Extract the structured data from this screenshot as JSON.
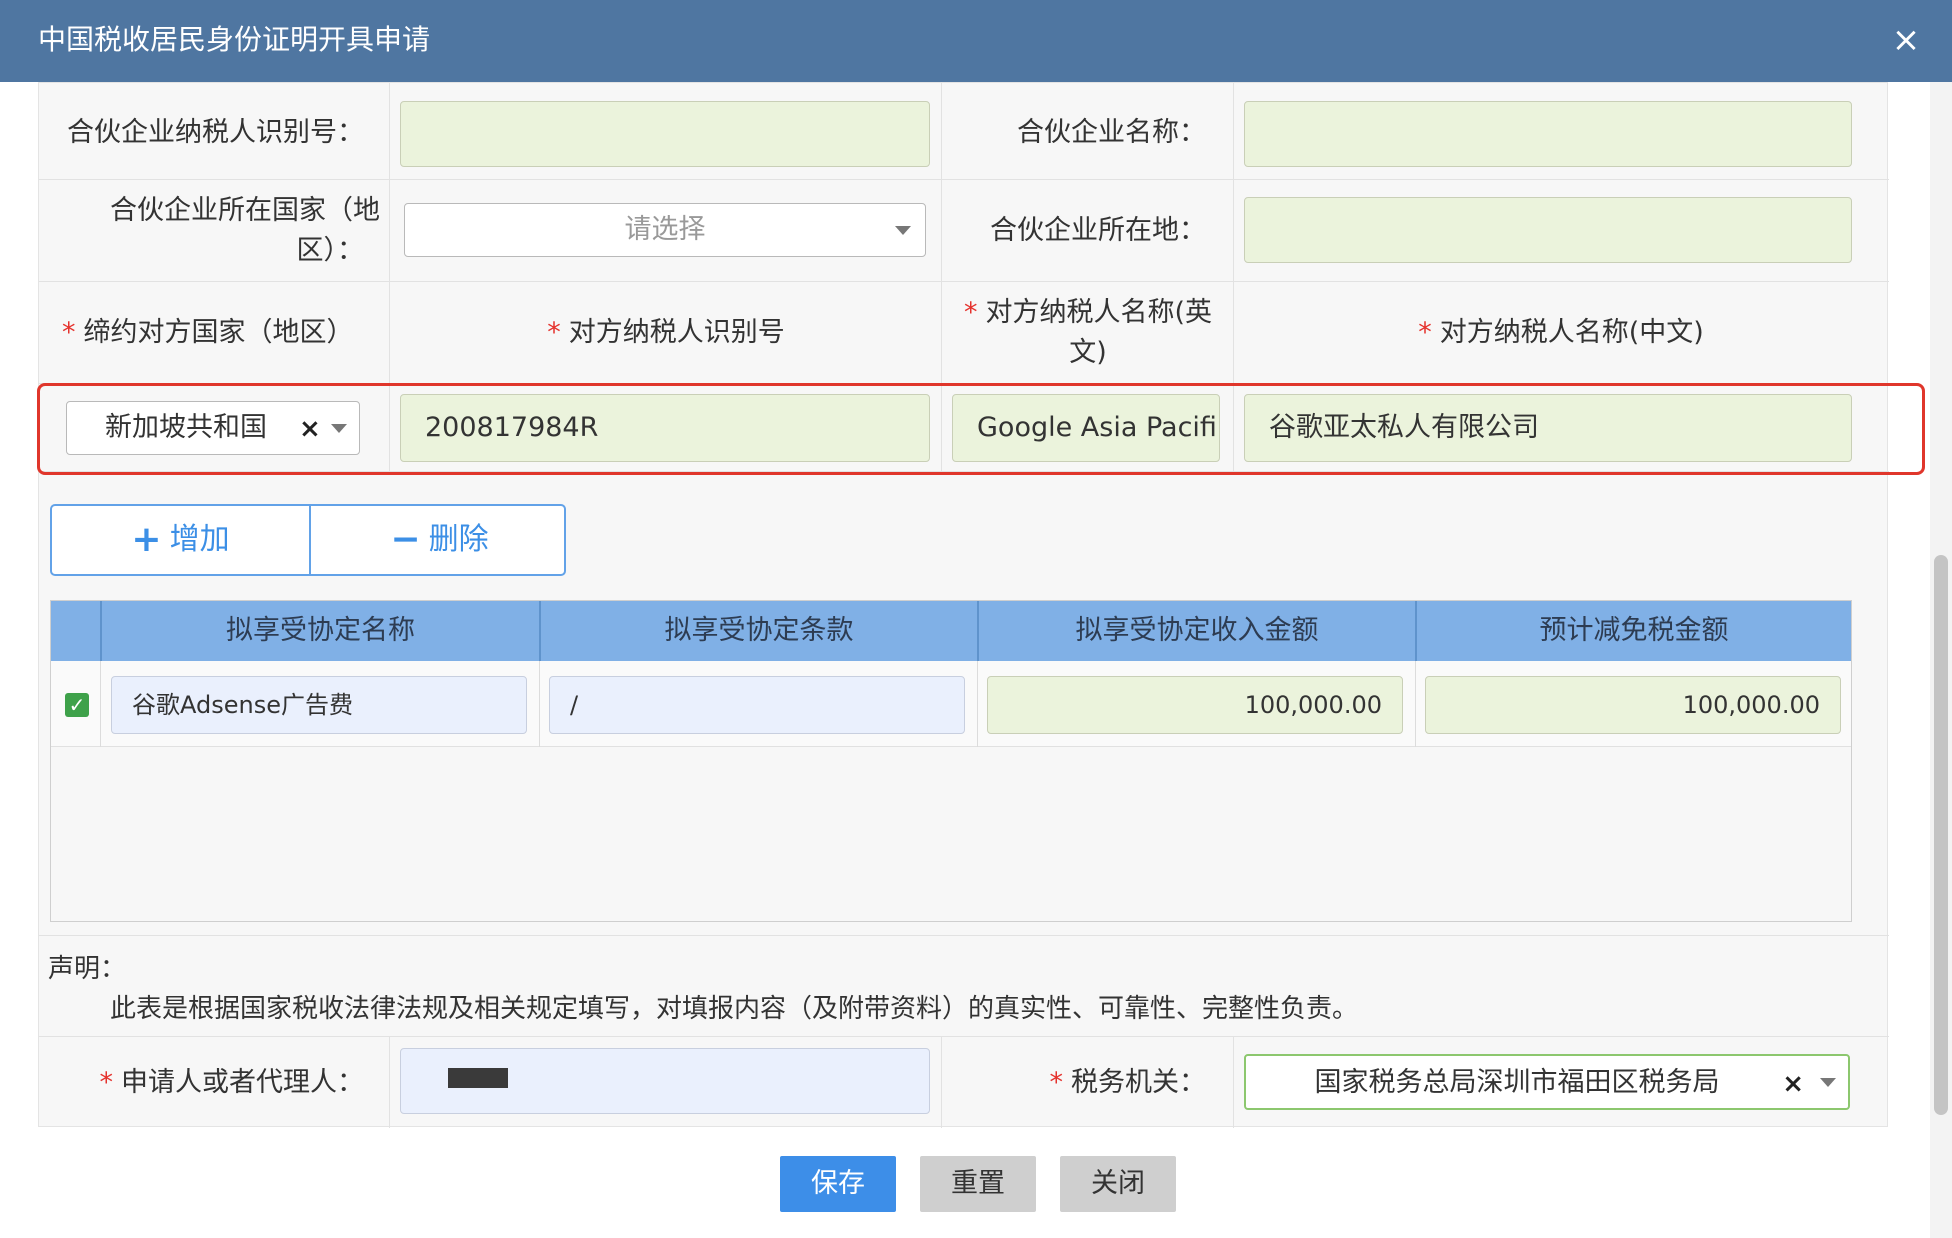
{
  "window": {
    "title": "中国税收居民身份证明开具申请",
    "close_glyph": "×"
  },
  "partner": {
    "tax_id_label": "合伙企业纳税人识别号：",
    "tax_id_value": "",
    "name_label": "合伙企业名称：",
    "name_value": "",
    "country_label_line1": "合伙企业所在国家（地",
    "country_label_line2": "区）：",
    "country_select_placeholder": "请选择",
    "location_label": "合伙企业所在地：",
    "location_value": ""
  },
  "treaty_headers": {
    "country": "缔约对方国家（地区）",
    "tax_id": "对方纳税人识别号",
    "name_en_line1": "对方纳税人名称(英",
    "name_en_line2": "文)",
    "name_cn": "对方纳税人名称(中文)",
    "required_mark": "*"
  },
  "treaty_row": {
    "country": "新加坡共和国",
    "clear_glyph": "×",
    "tax_id": "200817984R",
    "name_en": "Google Asia Pacifi",
    "name_cn": "谷歌亚太私人有限公司"
  },
  "actions": {
    "add_icon": "+",
    "add_label": "增加",
    "delete_icon": "−",
    "delete_label": "删除"
  },
  "grid": {
    "columns": [
      "拟享受协定名称",
      "拟享受协定条款",
      "拟享受协定收入金额",
      "预计减免税金额"
    ],
    "rows": [
      {
        "checked": "✓",
        "treaty_name": "谷歌Adsense广告费",
        "clause": "/",
        "income": "100,000.00",
        "relief": "100,000.00"
      }
    ]
  },
  "declaration": {
    "title": "声明：",
    "text": "此表是根据国家税收法律法规及相关规定填写，对填报内容（及附带资料）的真实性、可靠性、完整性负责。"
  },
  "applicant": {
    "label": "申请人或者代理人：",
    "tax_office_label": "税务机关：",
    "tax_office_value": "国家税务总局深圳市福田区税务局",
    "clear_glyph": "×"
  },
  "footer": {
    "save": "保存",
    "reset": "重置",
    "close": "关闭"
  }
}
